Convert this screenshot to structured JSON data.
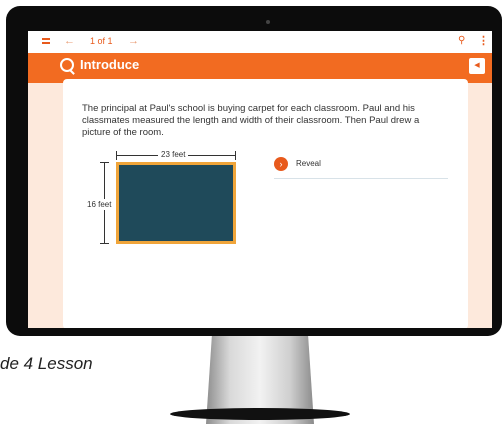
{
  "app": {
    "page_count": "1 of 1",
    "back_icon": "arrow-left-icon",
    "forward_icon": "arrow-right-icon",
    "menu_icon": "menu-icon",
    "search_icon": "search-icon",
    "more_icon": "more-vertical-icon"
  },
  "header": {
    "title": "Introduce",
    "icon": "lightbulb-icon",
    "accent_color": "#f26b21"
  },
  "content": {
    "prompt": "The principal at Paul's school is buying carpet for each classroom. Paul and his classmates measured the length and width of their classroom. Then Paul drew a picture of the room.",
    "width_label": "23 feet",
    "height_label": "16 feet",
    "room_color": "#1f4a5a",
    "room_border_color": "#f0a53a"
  },
  "reveal": {
    "label": "Reveal"
  },
  "caption": {
    "text": "de 4 Lesson"
  }
}
